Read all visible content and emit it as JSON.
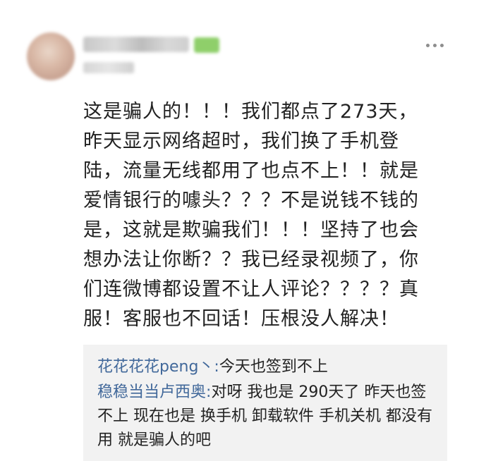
{
  "comment": {
    "lines": [
      "这是骗人的！！！我们都点了273天，",
      "昨天显示网络超时，我们换了手机登",
      "陆，流量无线都用了也点不上！！就是",
      "爱情银行的噱头？？？不是说钱不钱的",
      "是，这就是欺骗我们！！！坚持了也会",
      "想办法让你断？？我已经录视频了，你",
      "们连微博都设置不让人评论？？？？真",
      "服！客服也不回话！压根没人解决！"
    ]
  },
  "replies": [
    {
      "user": "花花花花peng丶",
      "sep": ":",
      "text": "今天也签到不上"
    },
    {
      "user": "稳稳当当卢西奥",
      "sep": ":",
      "text": "对呀 我也是 290天了 昨天也签不上 现在也是 换手机 卸载软件 手机关机 都没有用 就是骗人的吧"
    }
  ],
  "icons": {
    "more": "more-horizontal-icon"
  }
}
